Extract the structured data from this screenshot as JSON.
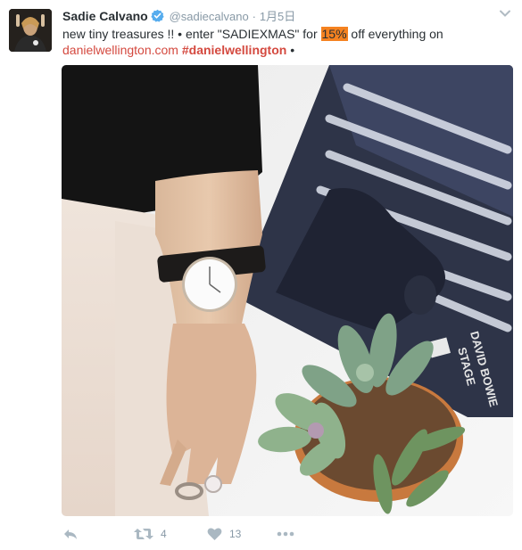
{
  "tweet": {
    "author_name": "Sadie Calvano",
    "author_handle": "@sadiecalvano",
    "separator": "·",
    "timestamp": "1月5日",
    "verified": true,
    "text_line1_a": "new tiny treasures !! • enter \"SADIEXMAS\" for ",
    "text_line1_highlight": "15%",
    "text_line1_b": " off everything on",
    "text_line2_link": "danielwellington.com",
    "text_line2_hashtag": "#danielwellington",
    "text_line2_end": " •",
    "media_description_icon": "photo-watch-record-succulent",
    "album_text": "DAVID BOWIE",
    "album_subtitle": "STAGE"
  },
  "actions": {
    "reply_icon": "reply-icon",
    "retweet_icon": "retweet-icon",
    "retweet_count": "4",
    "like_icon": "heart-icon",
    "like_count": "13",
    "more_icon": "more-icon"
  },
  "colors": {
    "link": "#d4493f",
    "highlight": "#f58220",
    "verified": "#55acee",
    "muted": "#8899a6"
  }
}
